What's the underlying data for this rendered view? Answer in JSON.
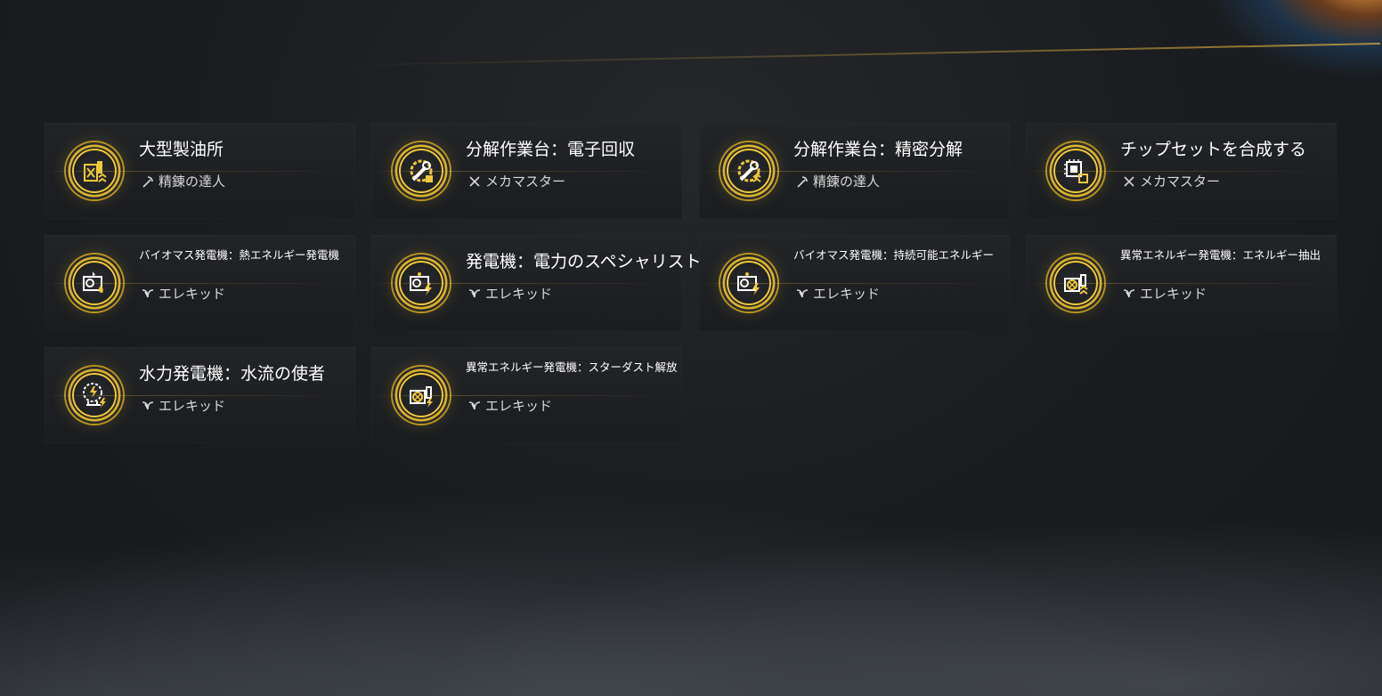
{
  "cards": [
    {
      "title": "大型製油所",
      "skill": "精錬の達人",
      "skill_icon": "pickaxe-icon",
      "icon": "oil-refinery-icon"
    },
    {
      "title": "分解作業台：電子回収",
      "skill": "メカマスター",
      "skill_icon": "crossed-tools-icon",
      "icon": "wrench-gear-icon"
    },
    {
      "title": "分解作業台：精密分解",
      "skill": "精錬の達人",
      "skill_icon": "pickaxe-icon",
      "icon": "wrench-gear-icon"
    },
    {
      "title": "チップセットを合成する",
      "skill": "メカマスター",
      "skill_icon": "crossed-tools-icon",
      "icon": "chipset-icon"
    },
    {
      "title": "バイオマス発電機：熱エネルギー発電機",
      "skill": "エレキッド",
      "skill_icon": "leaf-icon",
      "icon": "generator-icon"
    },
    {
      "title": "発電機：電力のスペシャリスト",
      "skill": "エレキッド",
      "skill_icon": "leaf-icon",
      "icon": "generator-icon"
    },
    {
      "title": "バイオマス発電機：持続可能エネルギー",
      "skill": "エレキッド",
      "skill_icon": "leaf-icon",
      "icon": "generator-icon"
    },
    {
      "title": "異常エネルギー発電機：エネルギー抽出",
      "skill": "エレキッド",
      "skill_icon": "leaf-icon",
      "icon": "anomaly-generator-icon"
    },
    {
      "title": "水力発電機：水流の使者",
      "skill": "エレキッド",
      "skill_icon": "leaf-icon",
      "icon": "water-wheel-icon"
    },
    {
      "title": "異常エネルギー発電機：スターダスト解放",
      "skill": "エレキッド",
      "skill_icon": "leaf-icon",
      "icon": "anomaly-generator-icon"
    }
  ],
  "colors": {
    "accent": "#f0c93c",
    "card_bg": "#222427",
    "background": "#1b1d20"
  }
}
